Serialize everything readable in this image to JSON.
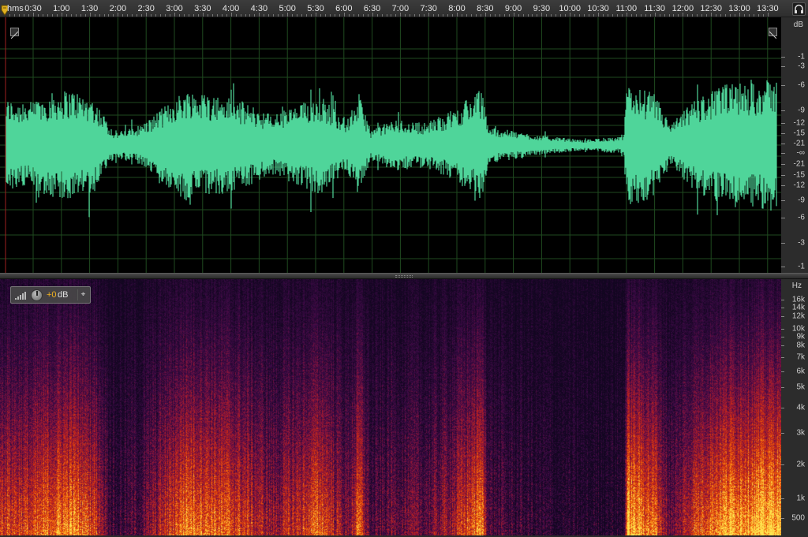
{
  "ruler": {
    "units_label": "hms",
    "time_labels": [
      "0:30",
      "1:00",
      "1:30",
      "2:00",
      "2:30",
      "3:00",
      "3:30",
      "4:00",
      "4:30",
      "5:00",
      "5:30",
      "6:00",
      "6:30",
      "7:00",
      "7:30",
      "8:00",
      "8:30",
      "9:00",
      "9:30",
      "10:00",
      "10:30",
      "11:00",
      "11:30",
      "12:00",
      "12:30",
      "13:00",
      "13:30"
    ]
  },
  "waveform": {
    "color": "#4fd59a",
    "grid_color": "#1f4a1f",
    "db_unit": "dB",
    "db_labels": [
      "-1",
      "-3",
      "-6",
      "-9",
      "-12",
      "-15",
      "-21",
      "-∞",
      "-21",
      "-15",
      "-12",
      "-9",
      "-6",
      "-3",
      "-1"
    ]
  },
  "spectrogram": {
    "hz_unit": "Hz",
    "hz_labels": [
      "16k",
      "14k",
      "12k",
      "10k",
      "9k",
      "8k",
      "7k",
      "6k",
      "5k",
      "4k",
      "3k",
      "2k",
      "1k",
      "500"
    ],
    "gain": {
      "value": "+0",
      "unit": "dB"
    }
  },
  "icons": {
    "playhead": "playhead-marker-icon",
    "headphones": "headphones-icon",
    "gain_bars": "level-bars-icon",
    "gain_knob": "knob-icon",
    "pin": "pin-icon"
  }
}
